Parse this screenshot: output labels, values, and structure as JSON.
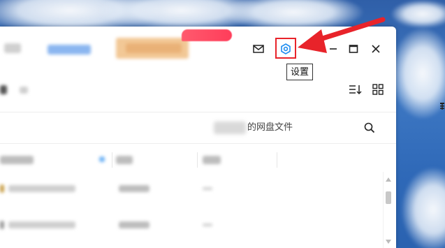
{
  "window": {
    "vip_badge_label": "",
    "tooltip": "设置",
    "search_placeholder": "的网盘文件"
  },
  "colors": {
    "accent_blue": "#1e8cf0",
    "highlight_red": "#e8232a",
    "badge_red": "#ff3d5a"
  },
  "icons": {
    "mail": "mail-icon",
    "settings": "settings-icon",
    "minimize": "minimize-icon",
    "maximize": "maximize-icon",
    "close": "close-icon",
    "sort": "sort-icon",
    "grid_view": "grid-view-icon",
    "search": "search-icon"
  }
}
